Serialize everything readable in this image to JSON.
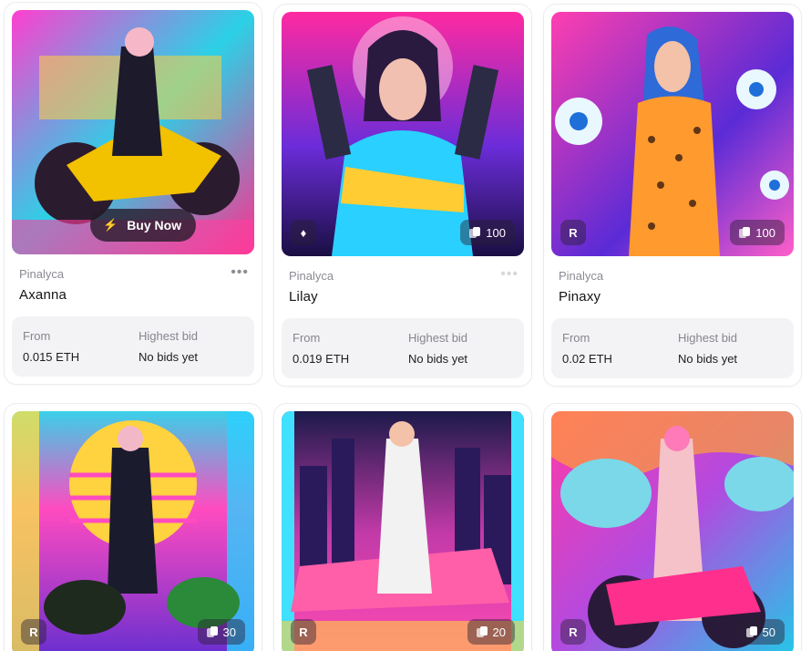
{
  "cards": [
    {
      "creator": "Pinalyca",
      "title": "Axanna",
      "buy_now_label": "Buy Now",
      "price_label": "From",
      "price_value": "0.015 ETH",
      "bid_label": "Highest bid",
      "bid_value": "No bids yet",
      "palette": [
        "#e63ad8",
        "#1ec9d9",
        "#ffd23f"
      ]
    },
    {
      "creator": "Pinalyca",
      "title": "Lilay",
      "edition_count": "100",
      "price_label": "From",
      "price_value": "0.019 ETH",
      "bid_label": "Highest bid",
      "bid_value": "No bids yet",
      "palette": [
        "#ff2aa1",
        "#6b2cd9",
        "#2ad0ff"
      ]
    },
    {
      "creator": "Pinalyca",
      "title": "Pinaxy",
      "edition_count": "100",
      "price_label": "From",
      "price_value": "0.02 ETH",
      "bid_label": "Highest bid",
      "bid_value": "No bids yet",
      "palette": [
        "#ff3fb0",
        "#5a2bd6",
        "#ff9a2e"
      ]
    },
    {
      "edition_count": "30",
      "palette": [
        "#ff4bc0",
        "#ffd23f",
        "#21b8e0"
      ]
    },
    {
      "edition_count": "20",
      "palette": [
        "#3a1c7a",
        "#ff4bb4",
        "#40e0ff"
      ]
    },
    {
      "edition_count": "50",
      "palette": [
        "#ff3aa8",
        "#24c7e8",
        "#ffa033"
      ]
    }
  ]
}
